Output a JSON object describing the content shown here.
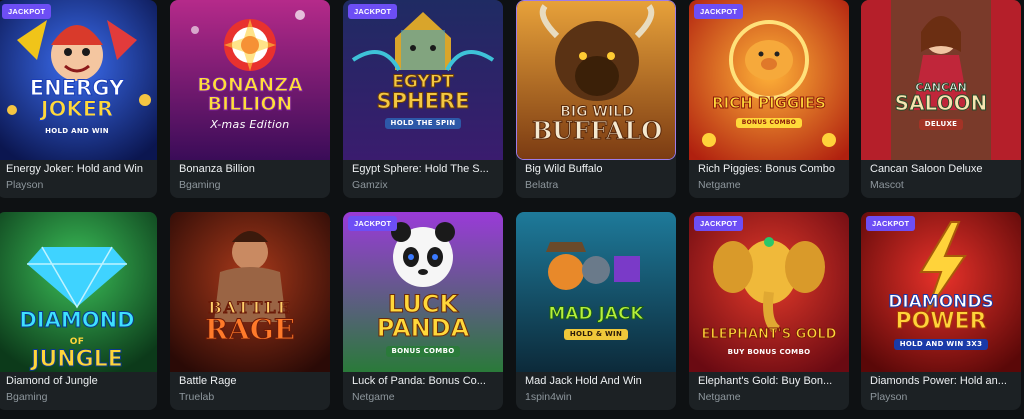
{
  "games": [
    {
      "name": "Energy Joker: Hold and Win",
      "provider": "Playson",
      "jackpot": "JACKPOT",
      "art": {
        "l1": "ENERGY",
        "l2": "JOKER",
        "sub": "HOLD AND WIN"
      }
    },
    {
      "name": "Bonanza Billion",
      "provider": "Bgaming",
      "jackpot": null,
      "art": {
        "l1": "BONANZA",
        "l2": "BILLION",
        "sub": "X-mas Edition"
      }
    },
    {
      "name": "Egypt Sphere: Hold The S...",
      "provider": "Gamzix",
      "jackpot": "JACKPOT",
      "art": {
        "l1": "EGYPT",
        "l2": "SPHERE",
        "sub": "HOLD THE SPIN"
      }
    },
    {
      "name": "Big Wild Buffalo",
      "provider": "Belatra",
      "jackpot": null,
      "art": {
        "l1": "BIG WILD",
        "l2": "BUFFALO",
        "sub": ""
      }
    },
    {
      "name": "Rich Piggies: Bonus Combo",
      "provider": "Netgame",
      "jackpot": "JACKPOT",
      "art": {
        "l1": "RICH PIGGIES",
        "l2": "",
        "sub": "BONUS COMBO"
      }
    },
    {
      "name": "Cancan Saloon Deluxe",
      "provider": "Mascot",
      "jackpot": null,
      "art": {
        "l1": "CANCAN",
        "l2": "SALOON",
        "sub": "DELUXE"
      }
    },
    {
      "name": "Diamond of Jungle",
      "provider": "Bgaming",
      "jackpot": null,
      "art": {
        "l1": "DIAMOND",
        "l2": "JUNGLE",
        "sub": "OF"
      }
    },
    {
      "name": "Battle Rage",
      "provider": "Truelab",
      "jackpot": null,
      "art": {
        "l1": "BATTLE",
        "l2": "RAGE",
        "sub": ""
      }
    },
    {
      "name": "Luck of Panda: Bonus Co...",
      "provider": "Netgame",
      "jackpot": "JACKPOT",
      "art": {
        "l1": "LUCK",
        "l2": "PANDA",
        "sub": "BONUS COMBO"
      }
    },
    {
      "name": "Mad Jack Hold And Win",
      "provider": "1spin4win",
      "jackpot": null,
      "art": {
        "l1": "MAD JACK",
        "l2": "",
        "sub": "HOLD & WIN"
      }
    },
    {
      "name": "Elephant's Gold: Buy Bon...",
      "provider": "Netgame",
      "jackpot": "JACKPOT",
      "art": {
        "l1": "ELEPHANT'S GOLD",
        "l2": "",
        "sub": "BUY BONUS COMBO"
      }
    },
    {
      "name": "Diamonds Power: Hold an...",
      "provider": "Playson",
      "jackpot": "JACKPOT",
      "art": {
        "l1": "DIAMONDS",
        "l2": "POWER",
        "sub": "HOLD AND WIN 3X3"
      }
    }
  ]
}
